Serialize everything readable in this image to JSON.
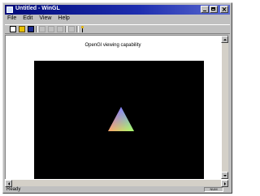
{
  "window": {
    "title": "Untitled - WinGL",
    "buttons": [
      "minimize",
      "maximize",
      "close"
    ]
  },
  "menu": {
    "items": [
      "File",
      "Edit",
      "View",
      "Help"
    ]
  },
  "toolbar": {
    "buttons": [
      "new-icon",
      "open-icon",
      "save-icon",
      "cut-icon",
      "copy-icon",
      "paste-icon",
      "print-icon",
      "help-icon"
    ]
  },
  "content": {
    "heading": "OpenGl viewing capability"
  },
  "status": {
    "text": "Ready",
    "indicator": "NUM"
  },
  "colors": {
    "titlebar": "#000a7a",
    "viewport_bg": "#000000",
    "triangle_top": "#2020ff",
    "triangle_left": "#ff1010",
    "triangle_right": "#10ff10"
  }
}
